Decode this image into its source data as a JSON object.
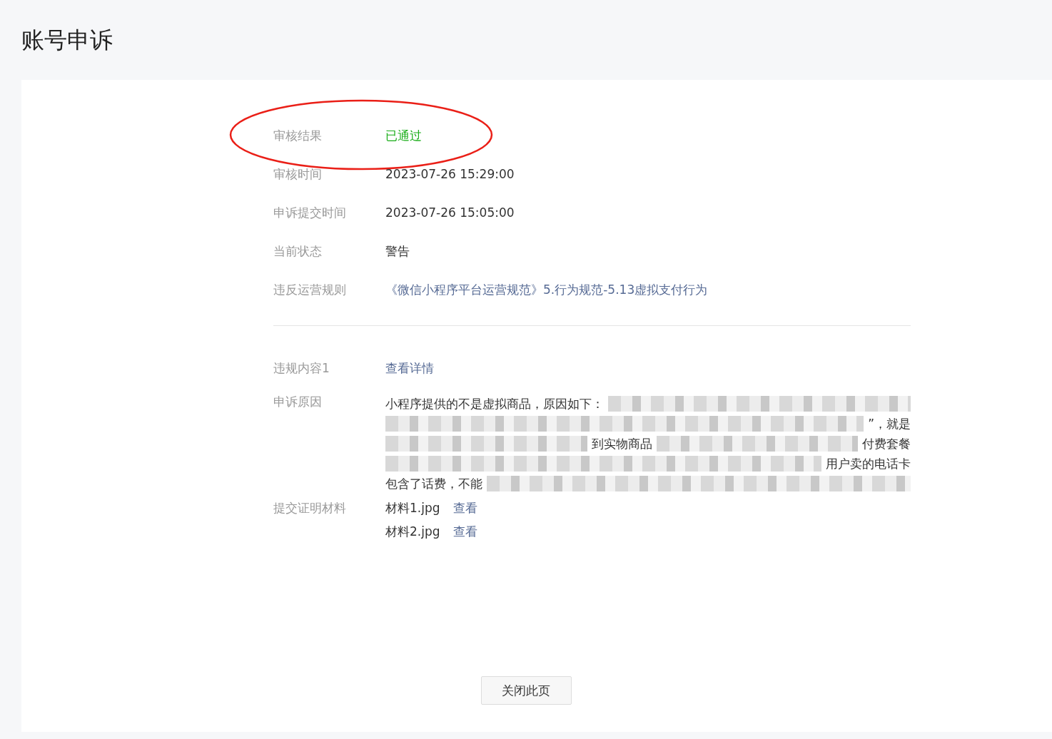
{
  "page_title": "账号申诉",
  "rows": [
    {
      "label": "审核结果",
      "value": "已通过",
      "kind": "status",
      "circled": true
    },
    {
      "label": "审核时间",
      "value": "2023-07-26 15:29:00",
      "kind": "text",
      "circled": false
    },
    {
      "label": "申诉提交时间",
      "value": "2023-07-26 15:05:00",
      "kind": "text",
      "circled": false
    },
    {
      "label": "当前状态",
      "value": "警告",
      "kind": "text",
      "circled": false
    },
    {
      "label": "违反运营规则",
      "value": "《微信小程序平台运营规范》5.行为规范-5.13虚拟支付行为",
      "kind": "link",
      "circled": false
    }
  ],
  "violation": {
    "label": "违规内容1",
    "link": "查看详情"
  },
  "reason": {
    "label": "申诉原因",
    "lines": [
      [
        {
          "kind": "text",
          "text": "小程序提供的不是虚拟商品，原因如下："
        },
        {
          "kind": "redacted"
        }
      ],
      [
        {
          "kind": "redacted"
        },
        {
          "kind": "text",
          "text": "”，就是"
        }
      ],
      [
        {
          "kind": "redacted"
        },
        {
          "kind": "text",
          "text": "到实物商品"
        },
        {
          "kind": "redacted"
        },
        {
          "kind": "text",
          "text": "付费套餐"
        }
      ],
      [
        {
          "kind": "redacted"
        },
        {
          "kind": "text",
          "text": "用户卖的电话卡"
        }
      ],
      [
        {
          "kind": "text",
          "text": "包含了话费，不能"
        },
        {
          "kind": "redacted"
        }
      ]
    ]
  },
  "materials": {
    "label": "提交证明材料",
    "files": [
      {
        "name": "材料1.jpg",
        "action": "查看"
      },
      {
        "name": "材料2.jpg",
        "action": "查看"
      }
    ]
  },
  "close_button": "关闭此页"
}
